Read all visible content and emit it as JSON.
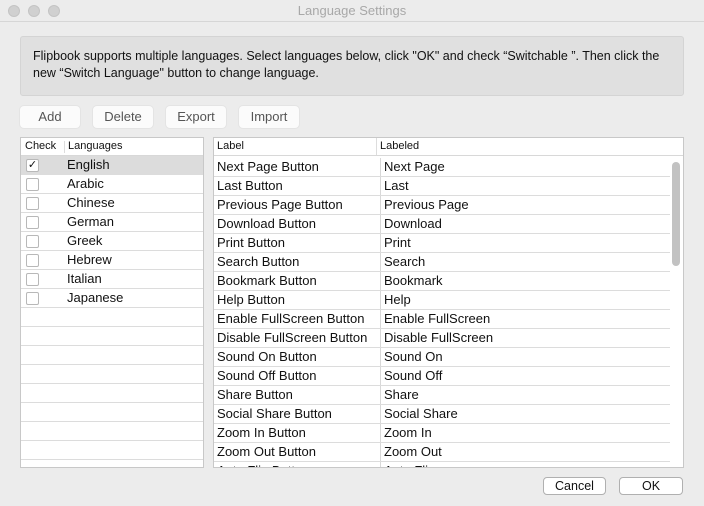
{
  "window": {
    "title": "Language Settings"
  },
  "info": {
    "text": "Flipbook supports multiple languages. Select languages below, click  \"OK\" and check “Switchable ”. Then click the new “Switch Language\" button to change language."
  },
  "toolbar": {
    "add": "Add",
    "delete": "Delete",
    "export": "Export",
    "import": "Import"
  },
  "languages": {
    "headers": {
      "check": "Check",
      "languages": "Languages"
    },
    "items": [
      {
        "name": "English",
        "checked": true
      },
      {
        "name": "Arabic",
        "checked": false
      },
      {
        "name": "Chinese",
        "checked": false
      },
      {
        "name": "German",
        "checked": false
      },
      {
        "name": "Greek",
        "checked": false
      },
      {
        "name": "Hebrew",
        "checked": false
      },
      {
        "name": "Italian",
        "checked": false
      },
      {
        "name": "Japanese",
        "checked": false
      }
    ]
  },
  "labels": {
    "headers": {
      "label": "Label",
      "labeled": "Labeled"
    },
    "rows": [
      [
        "Next Page Button",
        "Next Page"
      ],
      [
        "Last Button",
        "Last"
      ],
      [
        "Previous Page Button",
        "Previous Page"
      ],
      [
        "Download Button",
        "Download"
      ],
      [
        "Print Button",
        "Print"
      ],
      [
        "Search Button",
        "Search"
      ],
      [
        "Bookmark Button",
        "Bookmark"
      ],
      [
        "Help Button",
        "Help"
      ],
      [
        "Enable FullScreen Button",
        "Enable FullScreen"
      ],
      [
        "Disable FullScreen Button",
        "Disable FullScreen"
      ],
      [
        "Sound On Button",
        "Sound On"
      ],
      [
        "Sound Off Button",
        "Sound Off"
      ],
      [
        "Share Button",
        "Share"
      ],
      [
        "Social Share Button",
        "Social Share"
      ],
      [
        "Zoom In Button",
        "Zoom In"
      ],
      [
        "Zoom Out Button",
        "Zoom Out"
      ],
      [
        "Auto Flip Button",
        "Auto Flip"
      ]
    ]
  },
  "footer": {
    "cancel": "Cancel",
    "ok": "OK"
  }
}
